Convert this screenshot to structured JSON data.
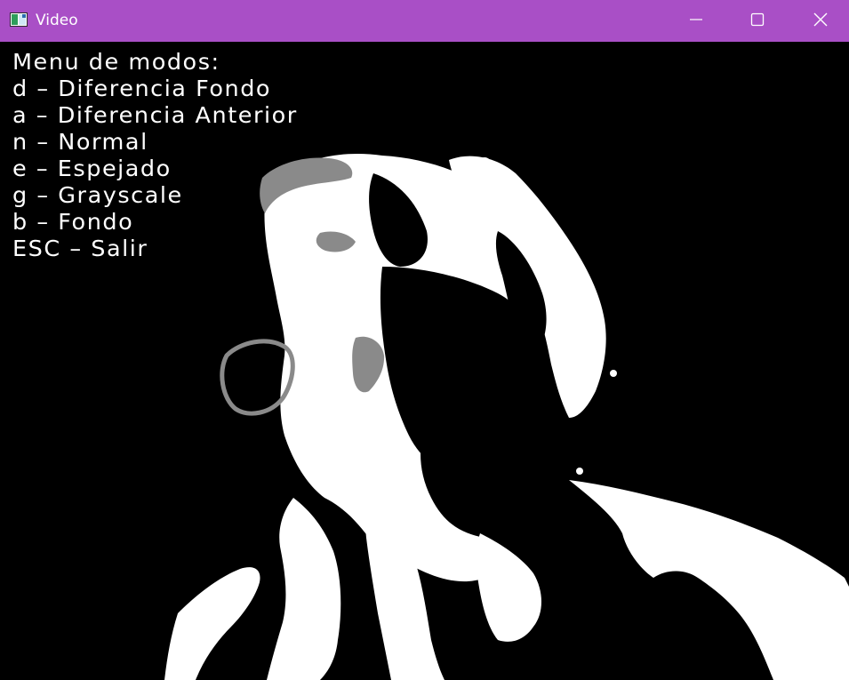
{
  "window": {
    "title": "Video",
    "titlebar_color": "#a94fc6",
    "icons": {
      "app": "video-window-icon",
      "minimize": "minimize-icon",
      "maximize": "maximize-icon",
      "close": "close-icon"
    }
  },
  "overlay": {
    "heading": "Menu de modos:",
    "items": [
      "d – Diferencia Fondo",
      "a – Diferencia Anterior",
      "n – Normal",
      "e – Espejado",
      "g – Grayscale",
      "b – Fondo",
      "ESC – Salir"
    ]
  }
}
